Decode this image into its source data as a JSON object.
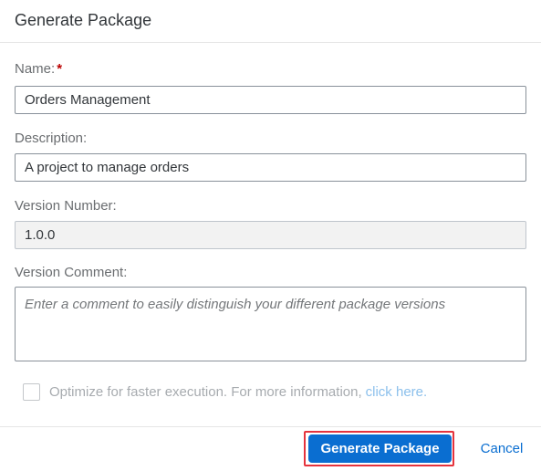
{
  "dialog": {
    "title": "Generate Package"
  },
  "form": {
    "name": {
      "label": "Name:",
      "required_marker": "*",
      "value": "Orders Management"
    },
    "description": {
      "label": "Description:",
      "value": "A project to manage orders"
    },
    "version_number": {
      "label": "Version Number:",
      "value": "1.0.0"
    },
    "version_comment": {
      "label": "Version Comment:",
      "placeholder": "Enter a comment to easily distinguish your different package versions"
    },
    "optimize": {
      "checked": false,
      "text": "Optimize for faster execution. For more information,",
      "link_text": "click here."
    }
  },
  "footer": {
    "primary_label": "Generate Package",
    "cancel_label": "Cancel"
  },
  "colors": {
    "accent": "#0a6ed1",
    "highlight": "#e5333d",
    "required": "#bb0000"
  }
}
